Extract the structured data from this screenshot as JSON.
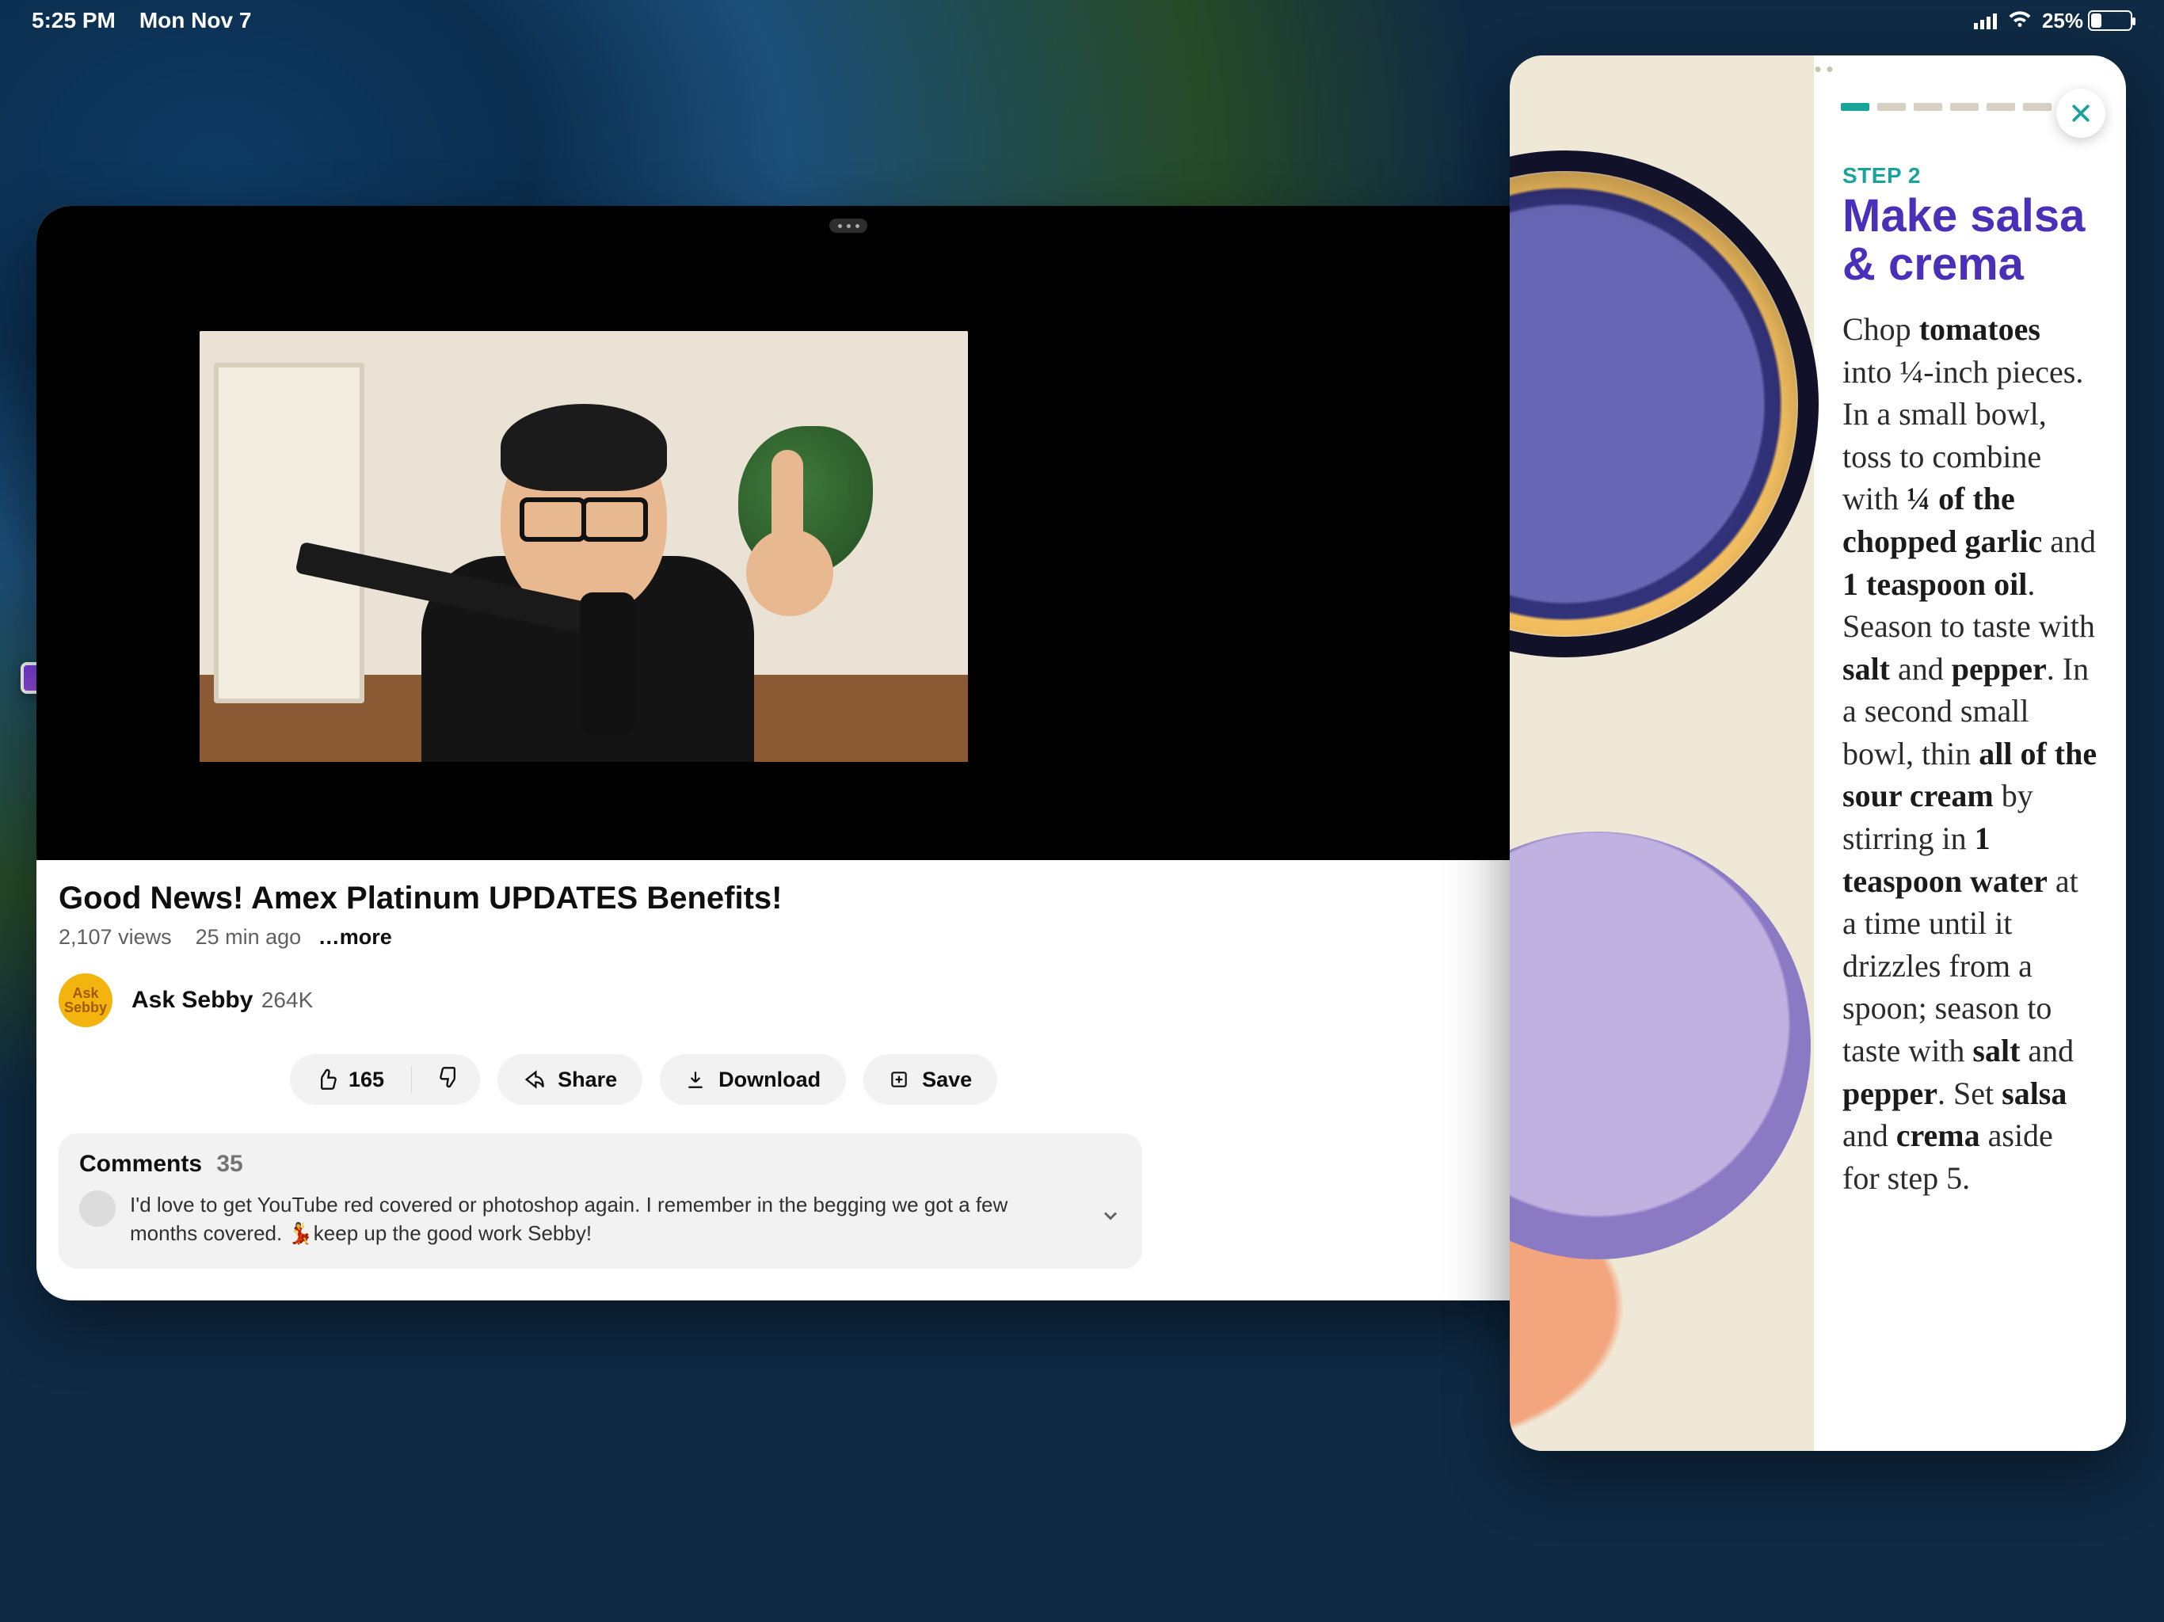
{
  "status": {
    "time": "5:25 PM",
    "date": "Mon Nov 7",
    "battery_pct": "25%"
  },
  "youtube": {
    "title": "Good News! Amex Platinum UPDATES Benefits!",
    "views": "2,107 views",
    "age": "25 min ago",
    "more": "…more",
    "channel": {
      "name": "Ask Sebby",
      "subs": "264K",
      "avatar_text": "Ask\nSebby"
    },
    "actions": {
      "like_count": "165",
      "share": "Share",
      "download": "Download",
      "save": "Save"
    },
    "comments": {
      "label": "Comments",
      "count": "35",
      "top": "I'd love to get YouTube red covered or photoshop again. I remember in the begging we got a few months covered. 💃keep up the good work Sebby!"
    }
  },
  "recipe": {
    "step_label": "STEP 2",
    "title": "Make salsa & crema",
    "segments": [
      {
        "t": "Chop "
      },
      {
        "t": "tomatoes",
        "b": true
      },
      {
        "t": " into ¼-inch pieces. In a small bowl, toss to combine with "
      },
      {
        "t": "¼ of the chopped garlic",
        "b": true
      },
      {
        "t": " and "
      },
      {
        "t": "1 teaspoon oil",
        "b": true
      },
      {
        "t": ". Season to taste with "
      },
      {
        "t": "salt",
        "b": true
      },
      {
        "t": " and "
      },
      {
        "t": "pepper",
        "b": true
      },
      {
        "t": ". In a second small bowl, thin "
      },
      {
        "t": "all of the sour cream",
        "b": true
      },
      {
        "t": " by stirring in "
      },
      {
        "t": "1 teaspoon water",
        "b": true
      },
      {
        "t": " at a time until it drizzles from a spoon; season to taste with "
      },
      {
        "t": "salt",
        "b": true
      },
      {
        "t": " and "
      },
      {
        "t": "pepper",
        "b": true
      },
      {
        "t": ". Set "
      },
      {
        "t": "salsa",
        "b": true
      },
      {
        "t": " and "
      },
      {
        "t": "crema",
        "b": true
      },
      {
        "t": " aside for step 5."
      }
    ],
    "progress_total": 6,
    "progress_active": 1
  }
}
